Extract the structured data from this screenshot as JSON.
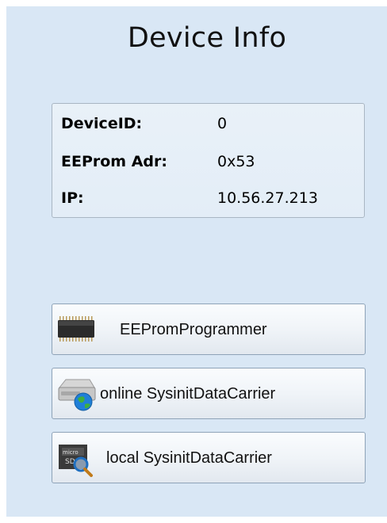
{
  "title": "Device Info",
  "info": [
    {
      "label": "DeviceID:",
      "value": "0"
    },
    {
      "label": "EEProm Adr:",
      "value": "0x53"
    },
    {
      "label": "IP:",
      "value": "10.56.27.213"
    }
  ],
  "buttons": {
    "eeprom": {
      "label": "EEPromProgrammer",
      "icon": "chip-icon"
    },
    "online": {
      "label": "online SysinitDataCarrier",
      "icon": "network-drive-icon"
    },
    "local": {
      "label": "local SysinitDataCarrier",
      "icon": "microsd-search-icon"
    }
  },
  "colors": {
    "background": "#d9e7f5",
    "accent": "#1f7fd8"
  }
}
